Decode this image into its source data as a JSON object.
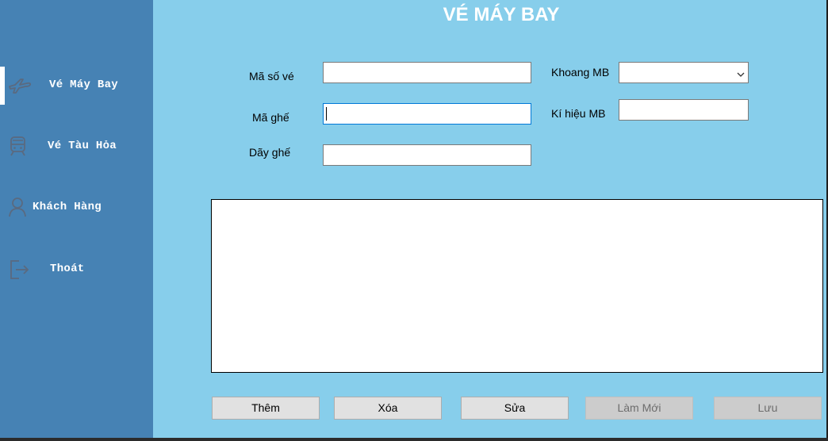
{
  "window": {
    "title": "VÉ MÁY BAY"
  },
  "sidebar": {
    "items": [
      {
        "label": "Vé Máy Bay",
        "icon": "airplane-icon",
        "active": true
      },
      {
        "label": "Vé Tàu Hỏa",
        "icon": "train-icon",
        "active": false
      },
      {
        "label": "Khách Hàng",
        "icon": "user-icon",
        "active": false
      },
      {
        "label": "Thoát",
        "icon": "exit-icon",
        "active": false
      }
    ]
  },
  "form": {
    "ma_so_ve": {
      "label": "Mã số vé",
      "value": ""
    },
    "ma_ghe": {
      "label": "Mã ghế",
      "value": ""
    },
    "day_ghe": {
      "label": "Dãy ghế",
      "value": ""
    },
    "khoang_mb": {
      "label": "Khoang MB",
      "value": ""
    },
    "ki_hieu_mb": {
      "label": "Kí hiệu MB",
      "value": ""
    }
  },
  "buttons": {
    "them": "Thêm",
    "xoa": "Xóa",
    "sua": "Sửa",
    "lam_moi": "Làm Mới",
    "luu": "Lưu"
  },
  "colors": {
    "sidebar": "#4682b4",
    "main": "#87ceeb",
    "icon": "#5a6a80"
  }
}
